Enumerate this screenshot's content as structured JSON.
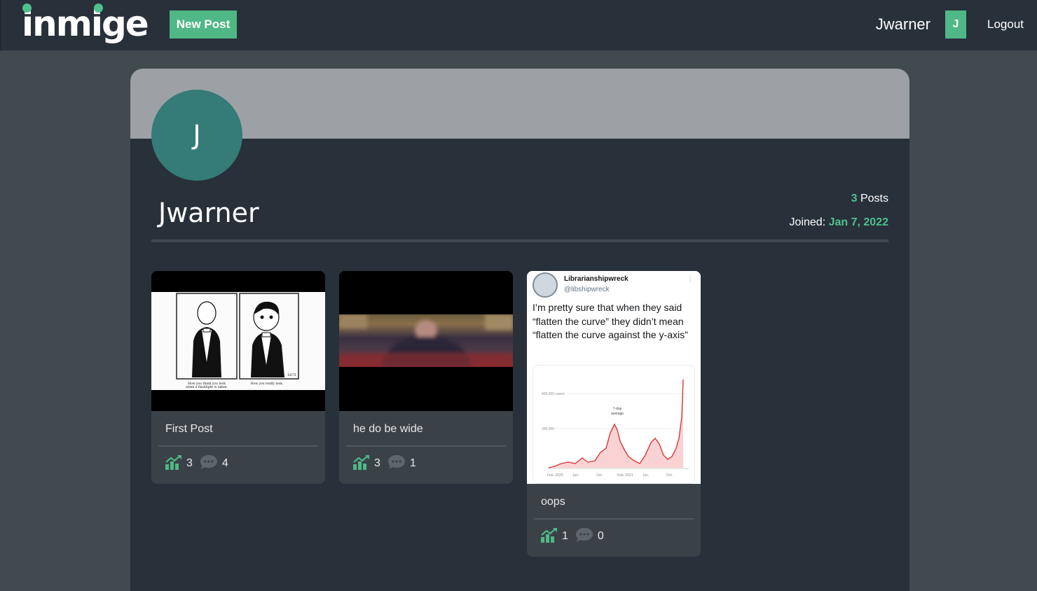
{
  "navbar": {
    "logo": "inmige",
    "new_post_label": "New Post",
    "username": "Jwarner",
    "avatar_initial": "J",
    "logout_label": "Logout"
  },
  "profile": {
    "avatar_initial": "J",
    "name": "Jwarner",
    "posts_count": "3",
    "posts_label": "Posts",
    "joined_label": "Joined:",
    "joined_date": "Jan 7, 2022"
  },
  "posts": [
    {
      "title": "First Post",
      "score": "3",
      "comments": "4"
    },
    {
      "title": "he do be wide",
      "score": "3",
      "comments": "1"
    },
    {
      "title": "oops",
      "score": "1",
      "comments": "0"
    }
  ],
  "tweet": {
    "name": "Librarianshipwreck",
    "handle": "@libshipwreck",
    "dots": "⋮",
    "text": "I’m pretty sure that when they said “flatten the curve” they didn’t mean “flatten the curve against the y-axis”",
    "chart_y1": "400,000 cases",
    "chart_y2": "200,000",
    "chart_note_1": "7-day",
    "chart_note_2": "average",
    "chart_x": [
      "Feb. 2020",
      "Jun.",
      "Oct.",
      "Feb. 2021",
      "Jun.",
      "Oct."
    ]
  },
  "comic": {
    "caption_left_1": "How you think you look",
    "caption_left_2": "when a flashlight is taken.",
    "caption_right": "How you really look.",
    "signature": "1875"
  },
  "colors": {
    "accent": "#4fc08d",
    "navbar_bg": "#283039",
    "page_bg": "#414a4f",
    "card_bg": "#3a4248",
    "avatar_bg": "#357b78"
  },
  "icons": {
    "score": "chart-up-icon",
    "comments": "speech-bubble-icon"
  }
}
